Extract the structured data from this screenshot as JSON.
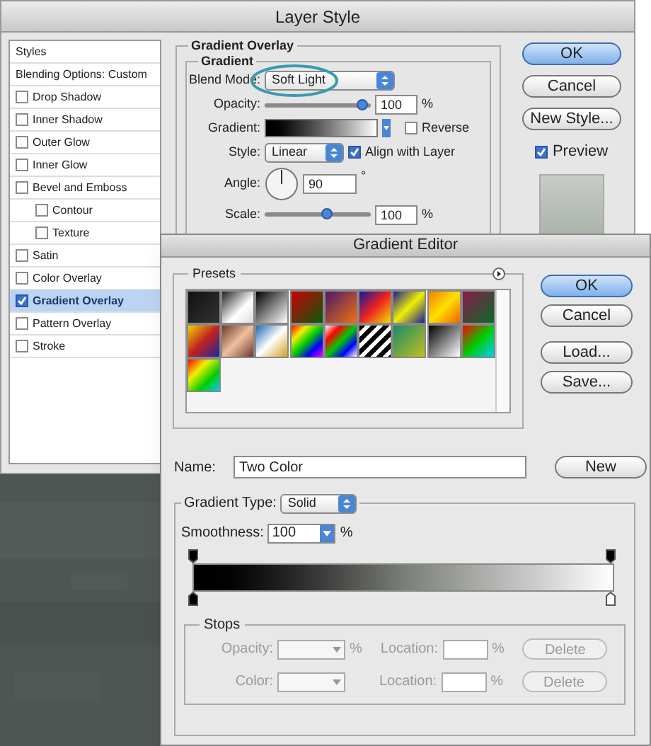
{
  "layer_style": {
    "title": "Layer Style",
    "styles_list": [
      {
        "label": "Styles",
        "kind": "header",
        "selected": false
      },
      {
        "label": "Blending Options: Custom",
        "kind": "header",
        "selected": false
      },
      {
        "label": "Drop Shadow",
        "kind": "check",
        "checked": false,
        "selected": false
      },
      {
        "label": "Inner Shadow",
        "kind": "check",
        "checked": false,
        "selected": false
      },
      {
        "label": "Outer Glow",
        "kind": "check",
        "checked": false,
        "selected": false
      },
      {
        "label": "Inner Glow",
        "kind": "check",
        "checked": false,
        "selected": false
      },
      {
        "label": "Bevel and Emboss",
        "kind": "check",
        "checked": false,
        "selected": false,
        "children": [
          {
            "label": "Contour",
            "kind": "check",
            "checked": false,
            "selected": false
          },
          {
            "label": "Texture",
            "kind": "check",
            "checked": false,
            "selected": false
          }
        ]
      },
      {
        "label": "Satin",
        "kind": "check",
        "checked": false,
        "selected": false
      },
      {
        "label": "Color Overlay",
        "kind": "check",
        "checked": false,
        "selected": false
      },
      {
        "label": "Gradient Overlay",
        "kind": "check",
        "checked": true,
        "selected": true
      },
      {
        "label": "Pattern Overlay",
        "kind": "check",
        "checked": false,
        "selected": false
      },
      {
        "label": "Stroke",
        "kind": "check",
        "checked": false,
        "selected": false
      }
    ],
    "group_title": "Gradient Overlay",
    "subgroup_title": "Gradient",
    "blend_mode": {
      "label": "Blend Mode:",
      "value": "Soft Light"
    },
    "opacity": {
      "label": "Opacity:",
      "level": 0.97,
      "value": "100",
      "unit": "%"
    },
    "gradient": {
      "label": "Gradient:"
    },
    "reverse": {
      "label": "Reverse",
      "checked": false
    },
    "style": {
      "label": "Style:",
      "value": "Linear"
    },
    "align": {
      "label": "Align with Layer",
      "checked": true
    },
    "angle": {
      "label": "Angle:",
      "value": "90",
      "unit": "°"
    },
    "scale": {
      "label": "Scale:",
      "level": 0.6,
      "value": "100",
      "unit": "%"
    },
    "buttons": [
      {
        "label": "OK",
        "kind": "default"
      },
      {
        "label": "Cancel",
        "kind": "normal"
      },
      {
        "label": "New Style...",
        "kind": "normal"
      }
    ],
    "preview": {
      "label": "Preview",
      "checked": true
    }
  },
  "gradient_editor": {
    "title": "Gradient Editor",
    "presets_title": "Presets",
    "buttons": [
      {
        "label": "OK",
        "kind": "default"
      },
      {
        "label": "Cancel",
        "kind": "normal"
      },
      {
        "label": "Load...",
        "kind": "normal"
      },
      {
        "label": "Save...",
        "kind": "normal"
      }
    ],
    "name": {
      "label": "Name:",
      "value": "Two Color"
    },
    "new_button": "New",
    "gradient_type": {
      "label": "Gradient Type:",
      "value": "Solid"
    },
    "smoothness": {
      "label": "Smoothness:",
      "value": "100",
      "unit": "%"
    },
    "stops": {
      "title": "Stops",
      "disabled": true,
      "rows": [
        {
          "label": "Opacity:",
          "unit": "%",
          "location_label": "Location:",
          "location_unit": "%",
          "button": "Delete"
        },
        {
          "label": "Color:",
          "location_label": "Location:",
          "location_unit": "%",
          "button": "Delete"
        }
      ]
    }
  }
}
